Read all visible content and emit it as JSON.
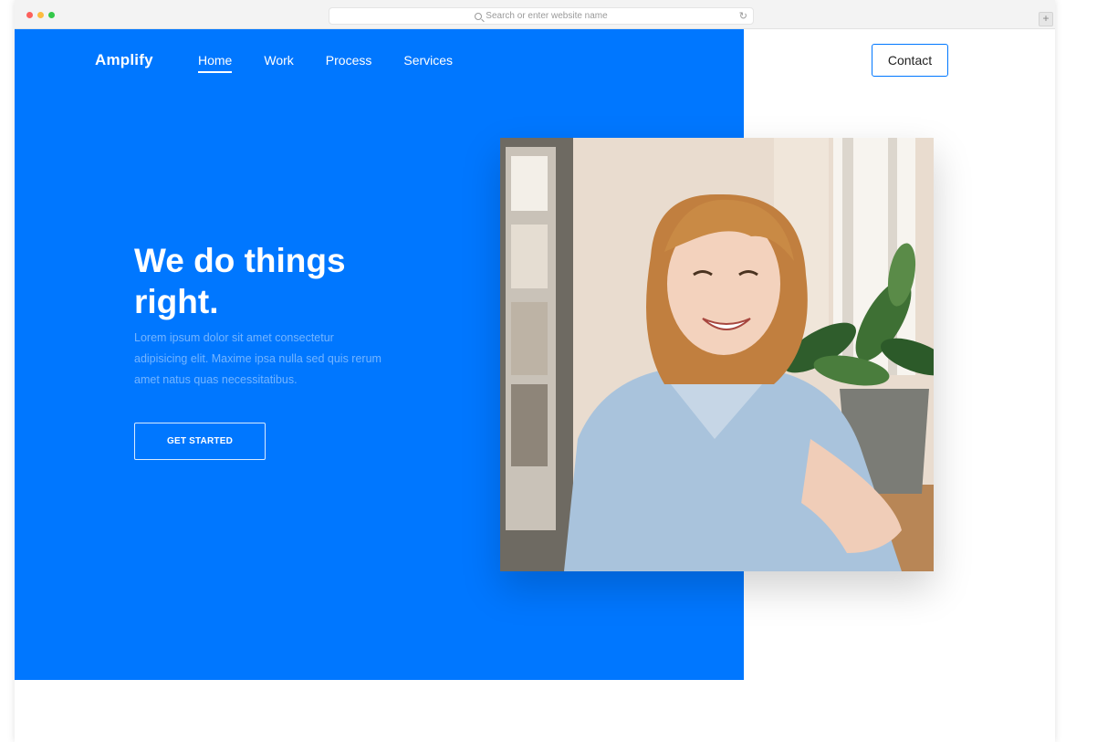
{
  "browser": {
    "url_placeholder": "Search or enter website name"
  },
  "site": {
    "logo": "Amplify",
    "nav": [
      {
        "label": "Home",
        "active": true
      },
      {
        "label": "Work",
        "active": false
      },
      {
        "label": "Process",
        "active": false
      },
      {
        "label": "Services",
        "active": false
      }
    ],
    "contact_label": "Contact"
  },
  "hero": {
    "headline": "We do things right.",
    "body": "Lorem ipsum dolor sit amet consectetur adipisicing elit. Maxime ipsa nulla sed quis rerum amet natus quas necessitatibus.",
    "cta_label": "GET STARTED"
  },
  "colors": {
    "brand_blue": "#0077ff"
  }
}
